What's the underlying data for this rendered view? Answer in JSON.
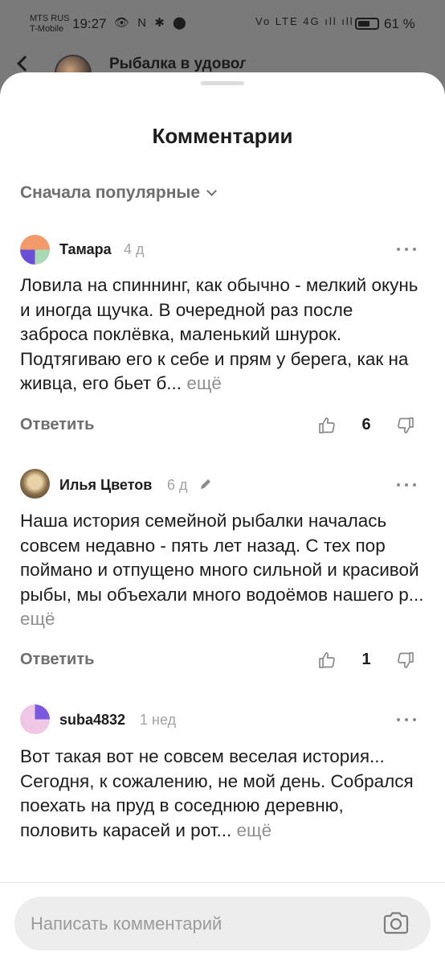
{
  "status_bar": {
    "carrier_1": "MTS RUS",
    "carrier_2": "T-Mobile",
    "time": "19:27",
    "left_icons": "👁 N ✱ ⬤",
    "right_icons": "Vo LTE 4G ıll ıll",
    "battery": "61 %"
  },
  "background_page": {
    "title": "Рыбалка в удовол"
  },
  "sheet": {
    "title": "Комментарии",
    "sort_label": "Сначала популярные"
  },
  "comments": [
    {
      "author": "Тамара",
      "time": "4 д",
      "text": "Ловила на спиннинг, как обычно - мелкий окунь и иногда щучка. В очередной раз после заброса поклёвка, маленький шнурок. Подтягиваю его к себе и прям у берега, как на живца, его бьет б...",
      "more": "ещё",
      "reply": "Ответить",
      "likes": "6",
      "edited": false
    },
    {
      "author": "Илья Цветов",
      "time": "6 д",
      "text": "Наша история семейной рыбалки началась совсем недавно - пять лет назад. С тех пор поймано и отпущено много сильной и красивой рыбы, мы объехали много водоёмов нашего р...",
      "more": "ещё",
      "reply": "Ответить",
      "likes": "1",
      "edited": true
    },
    {
      "author": "suba4832",
      "time": "1 нед",
      "text": "Вот такая вот не совсем веселая история...\nСегодня, к сожалению, не мой день. Собрался поехать на пруд в соседнюю деревню, половить карасей и рот...",
      "more": "ещё",
      "edited": false
    }
  ],
  "composer": {
    "placeholder": "Написать комментарий"
  },
  "colors": {
    "sheet_bg": "#ffffff",
    "overlay": "#7a7a7a",
    "text": "#1c1c1c",
    "muted": "#6e6e6e",
    "input_bg": "#ededed"
  }
}
